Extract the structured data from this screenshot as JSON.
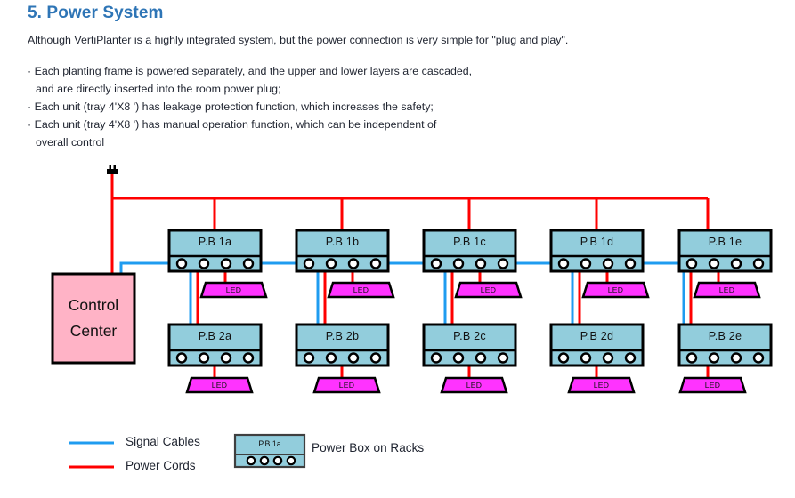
{
  "page": {
    "title": "5. Power System",
    "title_color": "#2e75b6",
    "intro": "Although VertiPlanter is a highly integrated system, but the power connection is very simple for \"plug and play\".",
    "bullets": [
      {
        "text": "· Each planting frame is powered separately, and the upper and lower layers are cascaded,",
        "continuation": false
      },
      {
        "text": "and are directly inserted into the room power plug;",
        "continuation": true
      },
      {
        "text": "· Each unit (tray 4'X8 ') has leakage protection function, which increases the safety;",
        "continuation": false
      },
      {
        "text": "· Each unit (tray 4'X8 ') has manual operation function, which can be independent of",
        "continuation": false
      },
      {
        "text": "overall control",
        "continuation": true
      }
    ]
  },
  "colors": {
    "signal_cable": "#1f9cf0",
    "power_cord": "#ff0000",
    "power_box_fill": "#92cddc",
    "power_box_stroke": "#000000",
    "control_center_fill": "#ffb3c6",
    "led_fill": "#ff33ff",
    "outlet_fill": "#ffffff",
    "title": "#2e75b6"
  },
  "diagram": {
    "control_center": {
      "line1": "Control",
      "line2": "Center"
    },
    "mains_plug": {
      "icon": "power-plug-icon"
    },
    "columns": [
      {
        "key": "a",
        "upper": {
          "label": "P.B 1a",
          "outlets": 4,
          "led": "LED"
        },
        "lower": {
          "label": "P.B 2a",
          "outlets": 4,
          "led": "LED"
        }
      },
      {
        "key": "b",
        "upper": {
          "label": "P.B 1b",
          "outlets": 4,
          "led": "LED"
        },
        "lower": {
          "label": "P.B 2b",
          "outlets": 4,
          "led": "LED"
        }
      },
      {
        "key": "c",
        "upper": {
          "label": "P.B 1c",
          "outlets": 4,
          "led": "LED"
        },
        "lower": {
          "label": "P.B 2c",
          "outlets": 4,
          "led": "LED"
        }
      },
      {
        "key": "d",
        "upper": {
          "label": "P.B 1d",
          "outlets": 4,
          "led": "LED"
        },
        "lower": {
          "label": "P.B 2d",
          "outlets": 4,
          "led": "LED"
        }
      },
      {
        "key": "e",
        "upper": {
          "label": "P.B 1e",
          "outlets": 4,
          "led": "LED"
        },
        "lower": {
          "label": "P.B 2e",
          "outlets": 4,
          "led": "LED"
        }
      }
    ]
  },
  "legend": {
    "signal_cables": "Signal Cables",
    "power_cords": "Power Cords",
    "power_box_sample_label": "P.B 1a",
    "power_box_caption": "Power Box on Racks"
  }
}
